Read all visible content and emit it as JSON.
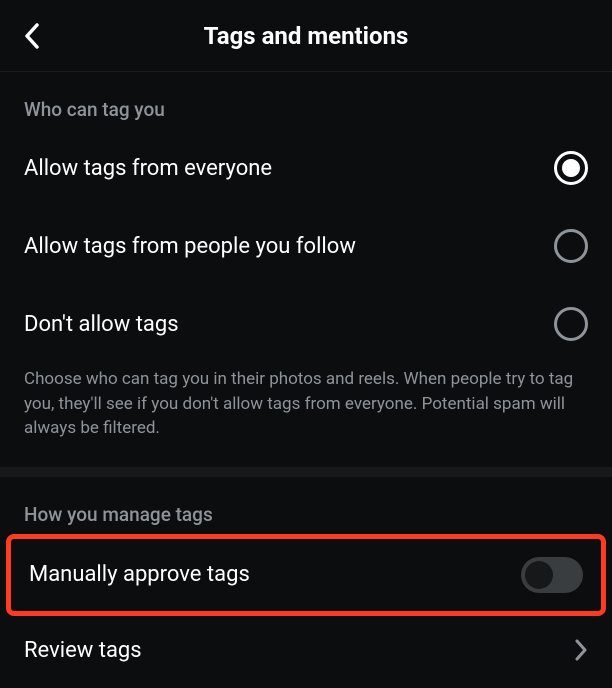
{
  "header": {
    "title": "Tags and mentions"
  },
  "sections": {
    "who_can_tag": {
      "title": "Who can tag you",
      "options": [
        {
          "label": "Allow tags from everyone",
          "selected": true
        },
        {
          "label": "Allow tags from people you follow",
          "selected": false
        },
        {
          "label": "Don't allow tags",
          "selected": false
        }
      ],
      "description": "Choose who can tag you in their photos and reels. When people try to tag you, they'll see if you don't allow tags from everyone. Potential spam will always be filtered."
    },
    "how_manage": {
      "title": "How you manage tags",
      "manually_approve": {
        "label": "Manually approve tags",
        "enabled": false
      },
      "review": {
        "label": "Review tags"
      }
    }
  },
  "icons": {
    "back": "back-icon",
    "chevron_right": "chevron-right-icon"
  },
  "colors": {
    "background": "#0b0d0f",
    "text_primary": "#ffffff",
    "text_secondary": "#8e949a",
    "highlight_border": "#ff3b1f",
    "toggle_track_off": "#3a3d40"
  }
}
